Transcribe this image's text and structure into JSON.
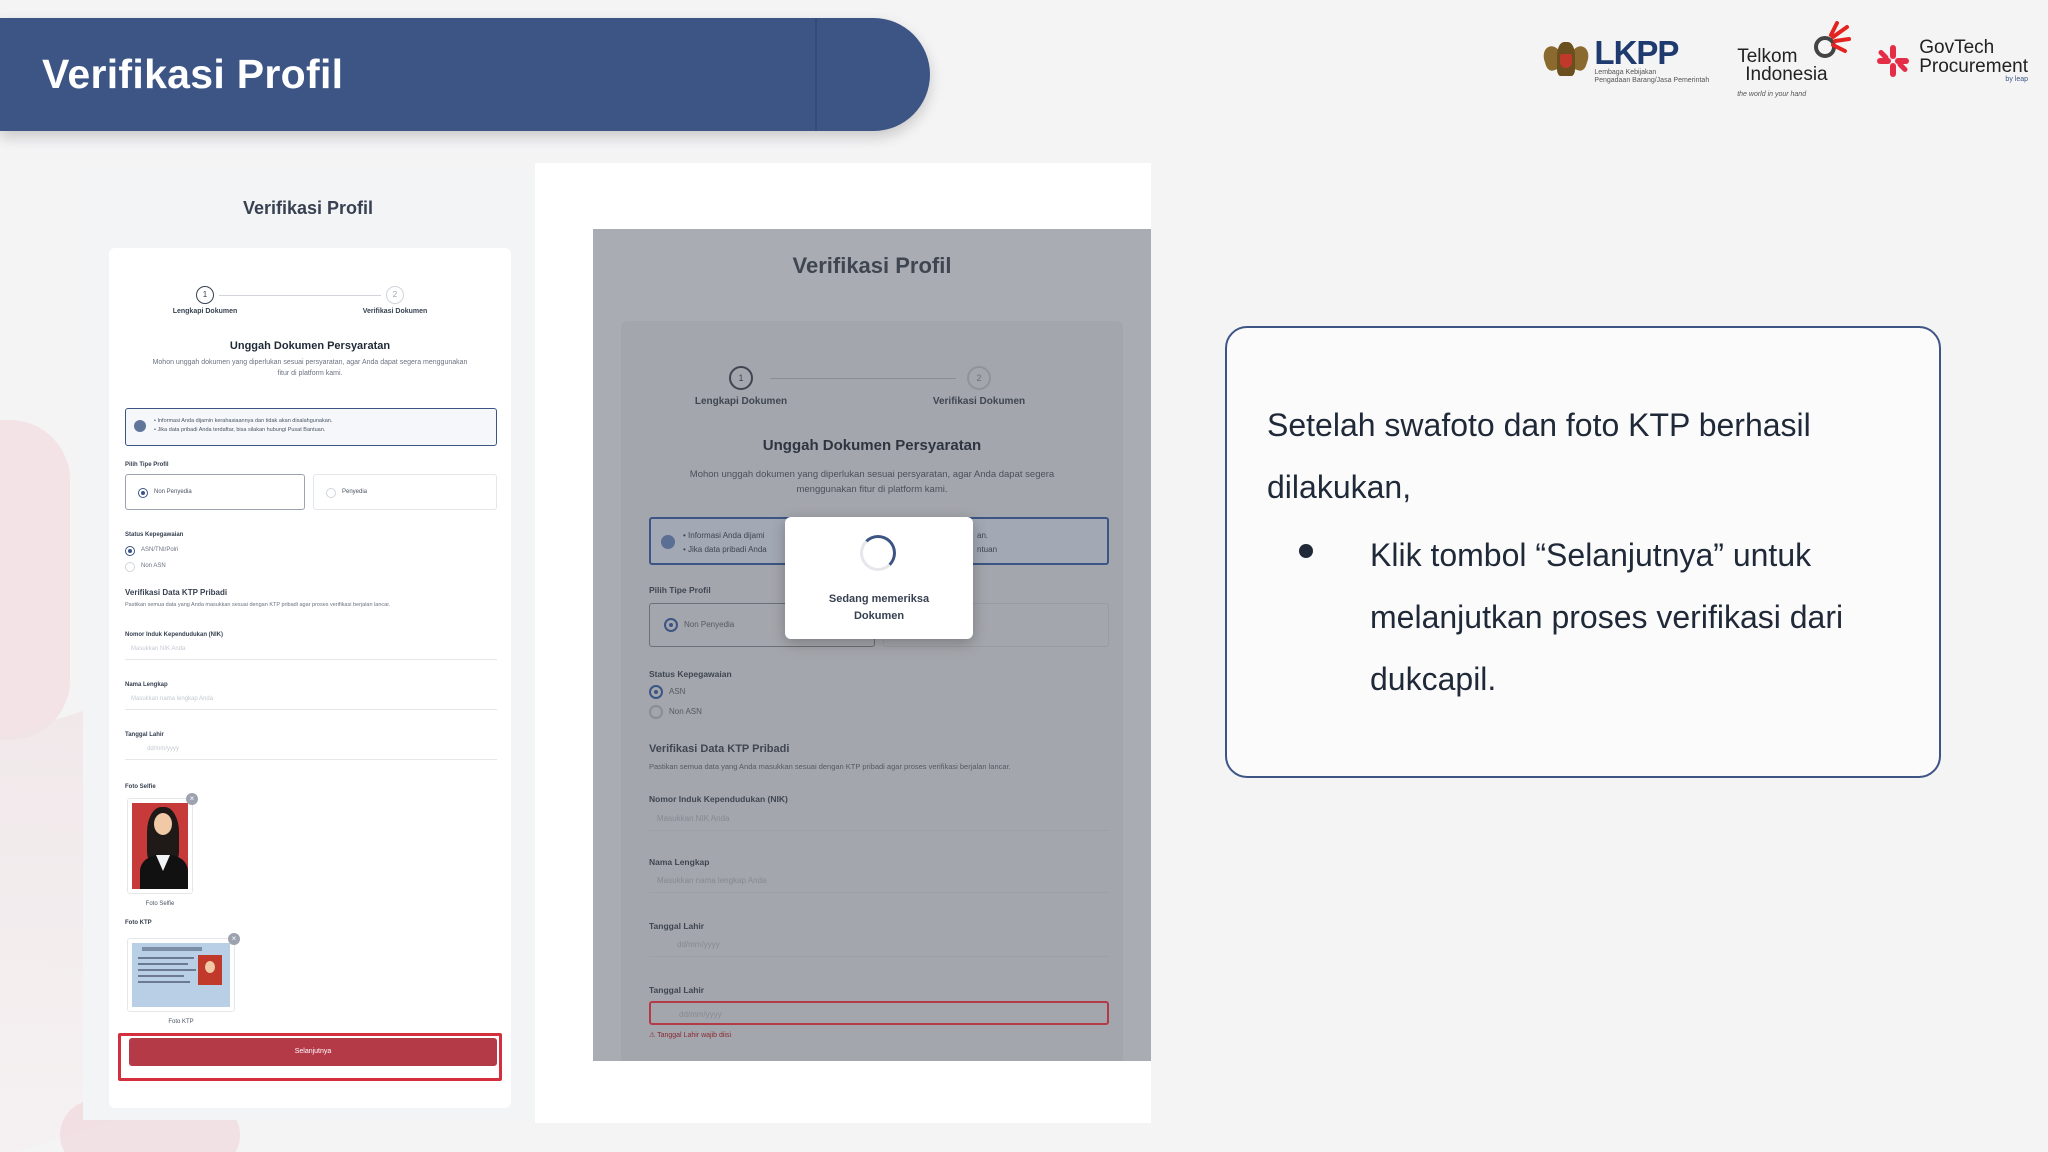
{
  "slide": {
    "title": "Verifikasi Profil",
    "accent_color": "#3d5584",
    "highlight_color": "#d32f3f"
  },
  "logos": {
    "lkpp": {
      "name": "LKPP",
      "subtitle_line1": "Lembaga Kebijakan",
      "subtitle_line2": "Pengadaan Barang/Jasa Pemerintah",
      "icon": "garuda-emblem-icon"
    },
    "telkom": {
      "line1": "Telkom",
      "line2": "Indonesia",
      "tagline": "the world in your hand",
      "icon": "telkom-swirl-icon"
    },
    "govtech": {
      "line1": "GovTech",
      "line2": "Procurement",
      "byline": "by leap",
      "icon": "govtech-star-icon"
    }
  },
  "left_screen": {
    "page_title": "Verifikasi Profil",
    "steps": [
      {
        "number": "1",
        "label": "Lengkapi Dokumen"
      },
      {
        "number": "2",
        "label": "Verifikasi Dokumen"
      }
    ],
    "section_title": "Unggah Dokumen Persyaratan",
    "section_subtitle": "Mohon unggah dokumen yang diperlukan sesuai persyaratan, agar Anda dapat segera menggunakan fitur di platform kami.",
    "alert_lines": [
      "• Informasi Anda dijamin kerahasiaannya dan tidak akan disalahgunakan.",
      "• Jika data pribadi Anda terdaftar, bisa silakan hubungi Pusat Bantuan."
    ],
    "profile_type_label": "Pilih Tipe Profil",
    "profile_options": [
      "Non Penyedia",
      "Penyedia"
    ],
    "employment_label": "Status Kepegawaian",
    "employment_options": [
      "ASN/TNI/Polri",
      "Non ASN"
    ],
    "ktp_section_title": "Verifikasi Data KTP Pribadi",
    "ktp_section_subtitle": "Pastikan semua data yang Anda masukkan sesuai dengan KTP pribadi agar proses verifikasi berjalan lancar.",
    "nik_label": "Nomor Induk Kependudukan (NIK)",
    "nik_placeholder": "Masukkan NIK Anda",
    "name_label": "Nama Lengkap",
    "name_placeholder": "Masukkan nama lengkap Anda",
    "dob_label": "Tanggal Lahir",
    "dob_placeholder": "dd/mm/yyyy",
    "selfie_label": "Foto Selfie",
    "selfie_caption": "Foto Selfie",
    "ktp_label": "Foto KTP",
    "ktp_caption": "Foto KTP",
    "next_button": "Selanjutnya"
  },
  "right_screen": {
    "page_title": "Verifikasi Profil",
    "steps": [
      {
        "number": "1",
        "label": "Lengkapi Dokumen"
      },
      {
        "number": "2",
        "label": "Verifikasi Dokumen"
      }
    ],
    "section_title": "Unggah Dokumen Persyaratan",
    "section_subtitle": "Mohon unggah dokumen yang diperlukan sesuai persyaratan, agar Anda dapat segera menggunakan fitur di platform kami.",
    "alert_lines": [
      "• Informasi Anda dijami",
      "• Jika data pribadi Anda"
    ],
    "alert_tail_lines": [
      "an.",
      "ntuan"
    ],
    "profile_type_label": "Pilih Tipe Profil",
    "profile_option": "Non Penyedia",
    "employment_label": "Status Kepegawaian",
    "employment_options": [
      "ASN",
      "Non ASN"
    ],
    "ktp_section_title": "Verifikasi Data KTP Pribadi",
    "ktp_section_subtitle": "Pastikan semua data yang Anda masukkan sesuai dengan KTP pribadi agar proses verifikasi berjalan lancar.",
    "nik_label": "Nomor Induk Kependudukan (NIK)",
    "nik_placeholder": "Masukkan NIK Anda",
    "name_label": "Nama Lengkap",
    "name_placeholder": "Masukkan nama lengkap Anda",
    "dob_label": "Tanggal Lahir",
    "dob_placeholder": "dd/mm/yyyy",
    "dob2_label": "Tanggal Lahir",
    "dob2_placeholder": "dd/mm/yyyy",
    "dob2_error": "⚠ Tanggal Lahir wajib diisi",
    "modal_text_line1": "Sedang memeriksa",
    "modal_text_line2": "Dokumen"
  },
  "instruction": {
    "intro": "Setelah swafoto dan foto KTP berhasil dilakukan,",
    "bullet": "Klik tombol “Selanjutnya” untuk melanjutkan proses verifikasi dari dukcapil."
  }
}
